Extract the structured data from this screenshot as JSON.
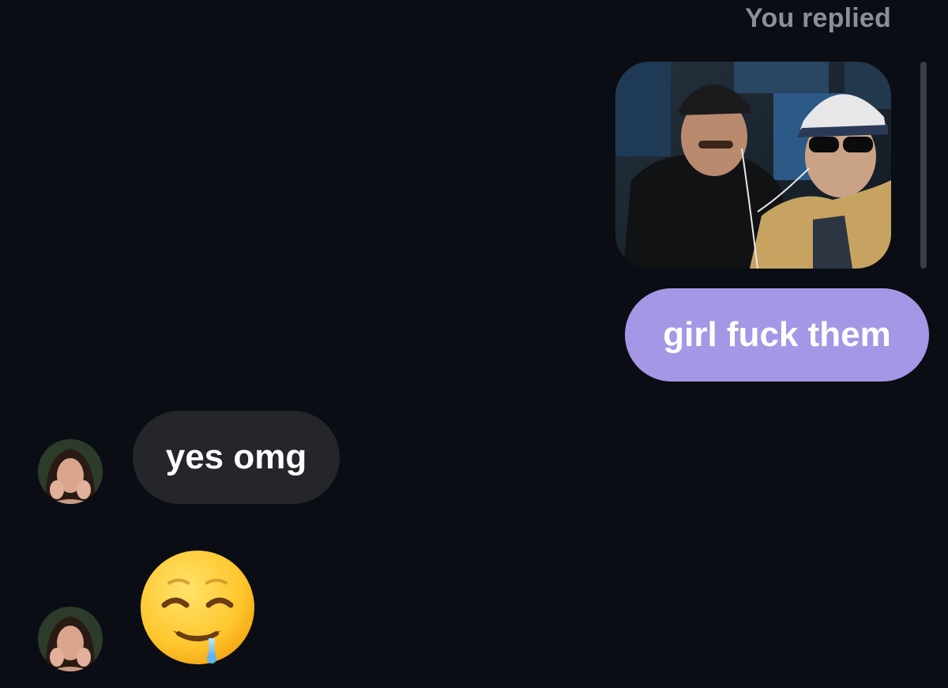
{
  "header": {
    "replied_label": "You replied"
  },
  "messages": {
    "outgoing_text": "girl fuck them",
    "incoming_text": "yes omg",
    "incoming_emoji": "drooling-face"
  },
  "colors": {
    "background": "#0a0d13",
    "outgoing_bubble": "#a597e6",
    "incoming_bubble": "#24262c",
    "muted_text": "#8c8f96"
  }
}
